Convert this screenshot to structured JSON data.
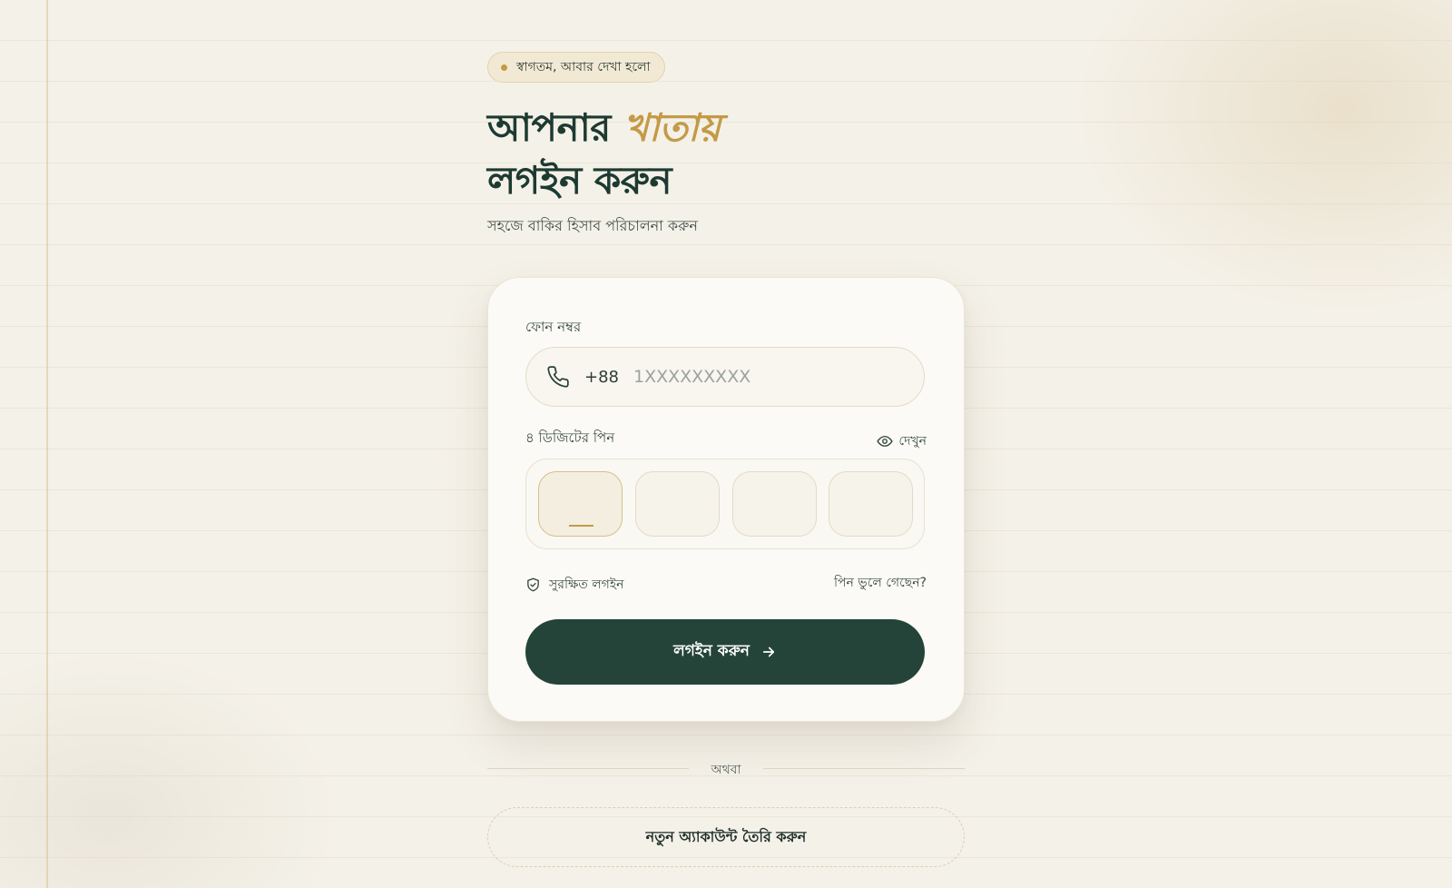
{
  "badge": {
    "text": "স্বাগতম, আবার দেখা হলো"
  },
  "headline": {
    "line1_prefix": "আপনার",
    "line1_accent": "খাতায়",
    "line2": "লগইন করুন"
  },
  "subtitle": "সহজে বাকির হিসাব পরিচালনা করুন",
  "login_form": {
    "phone_label": "ফোন নম্বর",
    "country_code": "+88",
    "phone_value": "",
    "phone_placeholder": "1XXXXXXXXX",
    "pin_label": "৪ ডিজিটের পিন",
    "show_label": "দেখুন",
    "pin_values": [
      "",
      "",
      "",
      ""
    ],
    "secure_label": "সুরক্ষিত লগইন",
    "forgot_label": "পিন ভুলে গেছেন?",
    "submit_label": "লগইন করুন"
  },
  "divider_text": "অথবা",
  "create_account_label": "নতুন অ্যাকাউন্ট তৈরি করুন",
  "icons": {
    "phone": "phone-icon",
    "eye": "eye-icon",
    "shield": "shield-check-icon",
    "arrow": "arrow-right-icon"
  },
  "colors": {
    "background": "#f4f1e8",
    "primary": "#24443a",
    "accent": "#c49a47",
    "card": "#fbfaf6",
    "text": "#1d3a31"
  }
}
